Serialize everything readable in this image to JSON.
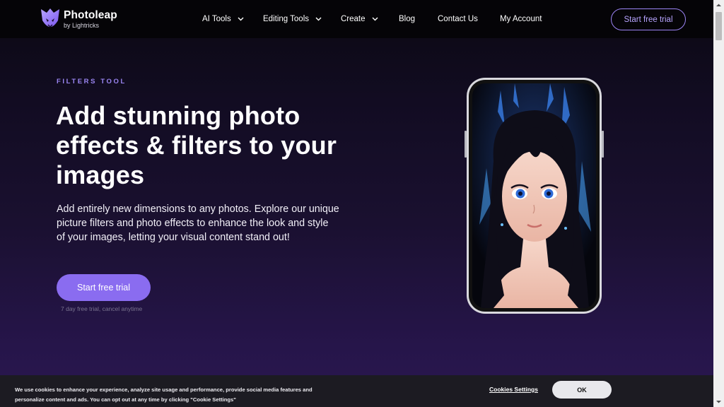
{
  "brand": {
    "name": "Photoleap",
    "sub": "by Lightricks",
    "color": "#8a6cf0"
  },
  "nav": {
    "items": [
      {
        "label": "AI Tools",
        "dropdown": true
      },
      {
        "label": "Editing Tools",
        "dropdown": true
      },
      {
        "label": "Create",
        "dropdown": true
      },
      {
        "label": "Blog",
        "dropdown": false
      },
      {
        "label": "Contact Us",
        "dropdown": false
      },
      {
        "label": "My Account",
        "dropdown": false
      }
    ],
    "cta": "Start free trial"
  },
  "hero": {
    "eyebrow": "FILTERS TOOL",
    "headline": "Add stunning photo effects & filters to your images",
    "description": "Add entirely new dimensions to any photos. Explore our unique picture filters and photo effects to enhance the look and style of your images, letting your visual content stand out!",
    "cta": "Start free trial",
    "cta_note": "7 day free trial, cancel anytime"
  },
  "phone_image": {
    "subject": "anime-style portrait of a girl with dark hair and glowing blue effects",
    "accent": "#4aa8ff"
  },
  "cookie": {
    "text": "We use cookies to enhance your experience, analyze site usage and performance, provide social media features and personalize content and ads. You can opt out at any time by clicking \"Cookie Settings\"",
    "settings_label": "Cookies Settings",
    "ok_label": "OK"
  },
  "icons": {
    "chevron": "chevron-down-icon",
    "logo": "photoleap-logo-icon"
  }
}
